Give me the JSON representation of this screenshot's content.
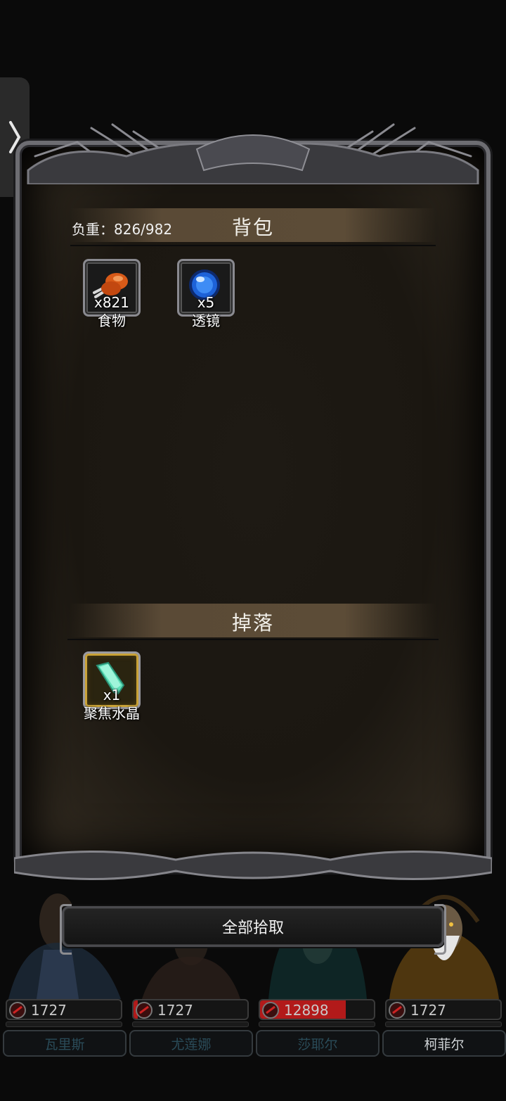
{
  "side_tab": {
    "icon": "chevron-right-icon",
    "glyph": "❭"
  },
  "backpack": {
    "title": "背包",
    "weight_label": "负重：826/982",
    "items": [
      {
        "name": "食物",
        "count": "x821",
        "icon": "food-meat-icon",
        "rarity": "normal"
      },
      {
        "name": "透镜",
        "count": "x5",
        "icon": "blue-lens-orb-icon",
        "rarity": "normal"
      }
    ]
  },
  "drops": {
    "title": "掉落",
    "items": [
      {
        "name": "聚焦水晶",
        "count": "x1",
        "icon": "focus-crystal-icon",
        "rarity": "gold"
      }
    ]
  },
  "pickup_all_label": "全部拾取",
  "party": [
    {
      "name": "瓦里斯",
      "hp": "1727",
      "hp_fraction": 0.0,
      "active": false
    },
    {
      "name": "尤莲娜",
      "hp": "1727",
      "hp_fraction": 0.04,
      "active": false
    },
    {
      "name": "莎耶尔",
      "hp": "12898",
      "hp_fraction": 0.75,
      "active": false
    },
    {
      "name": "柯菲尔",
      "hp": "1727",
      "hp_fraction": 0.0,
      "active": true
    }
  ],
  "colors": {
    "hp_red": "#b21a1a",
    "gold_border": "#c9a236",
    "panel_brown": "#5a4a36"
  }
}
